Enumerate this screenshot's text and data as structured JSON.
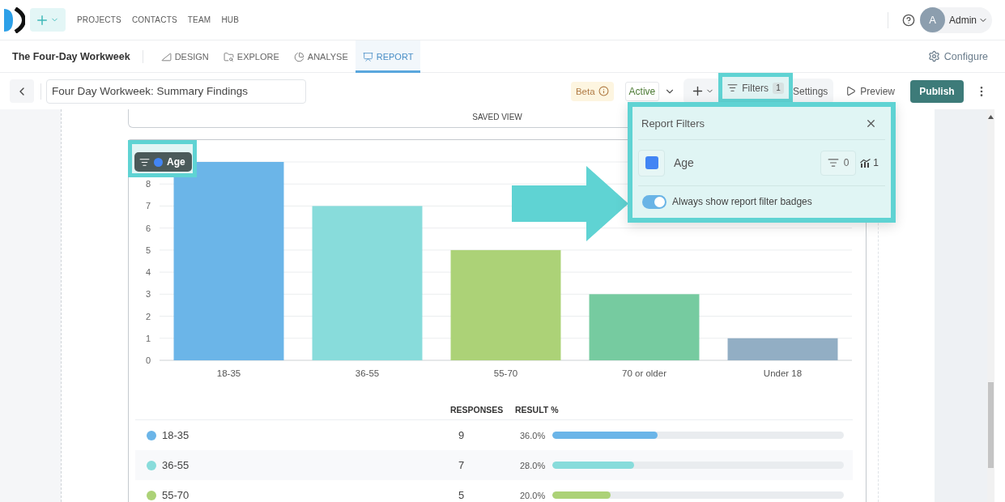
{
  "top_nav": {
    "items": [
      "PROJECTS",
      "CONTACTS",
      "TEAM",
      "HUB"
    ],
    "user": {
      "initial": "A",
      "name": "Admin"
    }
  },
  "project_bar": {
    "title": "The Four-Day Workweek",
    "tabs": [
      {
        "label": "DESIGN",
        "selected": false
      },
      {
        "label": "EXPLORE",
        "selected": false
      },
      {
        "label": "ANALYSE",
        "selected": false
      },
      {
        "label": "REPORT",
        "selected": true
      }
    ],
    "configure": "Configure"
  },
  "report_toolbar": {
    "title": "Four Day Workweek: Summary Findings",
    "beta": "Beta",
    "status": "Active",
    "filters": {
      "label": "Filters",
      "count": "1",
      "highlighted": true
    },
    "settings": "Settings",
    "preview": "Preview",
    "publish": "Publish"
  },
  "saved_view": {
    "label": "SAVED VIEW"
  },
  "chart": {
    "filter_badge": {
      "label": "Age",
      "color": "#4285f4",
      "highlighted": true
    },
    "chart_data": {
      "type": "bar",
      "categories": [
        "18-35",
        "36-55",
        "55-70",
        "70 or older",
        "Under 18"
      ],
      "series": [
        {
          "color": "#6bb5e8",
          "values": [
            9,
            null,
            null,
            null,
            null
          ]
        },
        {
          "color": "#88dcdb",
          "values": [
            null,
            7,
            null,
            null,
            null
          ]
        },
        {
          "color": "#acd277",
          "values": [
            null,
            null,
            5,
            null,
            null
          ]
        },
        {
          "color": "#76cba0",
          "values": [
            null,
            null,
            null,
            3,
            null
          ]
        },
        {
          "color": "#92aec4",
          "values": [
            null,
            null,
            null,
            null,
            1
          ]
        }
      ],
      "stacked": true,
      "grid": true,
      "ylim": [
        0,
        9
      ],
      "yticks": [
        0,
        1,
        2,
        3,
        4,
        5,
        6,
        7,
        8
      ]
    }
  },
  "results_table": {
    "columns": [
      "RESPONSES",
      "RESULT %"
    ],
    "rows": [
      {
        "label": "18-35",
        "color": "#6bb5e8",
        "responses": "9",
        "result": "36.0%",
        "level": 0.36
      },
      {
        "label": "36-55",
        "color": "#88dcdb",
        "responses": "7",
        "result": "28.0%",
        "level": 0.28
      },
      {
        "label": "55-70",
        "color": "#acd277",
        "responses": "5",
        "result": "20.0%",
        "level": 0.2
      }
    ]
  },
  "report_filters": {
    "title": "Report Filters",
    "highlighted": true,
    "filters": [
      {
        "label": "Age",
        "color": "#4285f4",
        "filter_count": "0",
        "chart_count": "1"
      }
    ],
    "badge_toggle": {
      "label": "Always show report filter badges",
      "on": true
    }
  }
}
